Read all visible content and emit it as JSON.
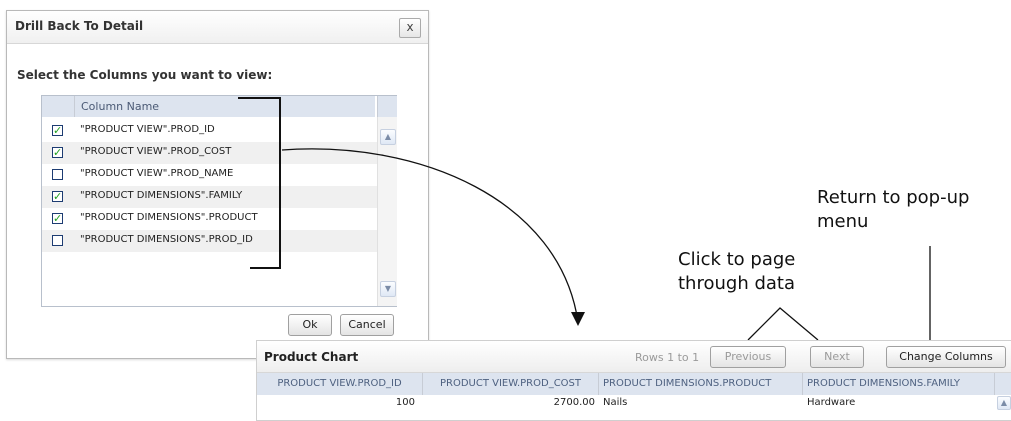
{
  "dialog": {
    "title": "Drill Back To Detail",
    "close_label": "x",
    "prompt": "Select the Columns you want to view:",
    "column_header": "Column Name",
    "columns": [
      {
        "label": "\"PRODUCT VIEW\".PROD_ID",
        "checked": true
      },
      {
        "label": "\"PRODUCT VIEW\".PROD_COST",
        "checked": true
      },
      {
        "label": "\"PRODUCT VIEW\".PROD_NAME",
        "checked": false
      },
      {
        "label": "\"PRODUCT DIMENSIONS\".FAMILY",
        "checked": true
      },
      {
        "label": "\"PRODUCT DIMENSIONS\".PRODUCT",
        "checked": true
      },
      {
        "label": "\"PRODUCT DIMENSIONS\".PROD_ID",
        "checked": false
      }
    ],
    "ok_label": "Ok",
    "cancel_label": "Cancel",
    "scroll_up_icon": "chevron-up-icon",
    "scroll_down_icon": "chevron-down-icon"
  },
  "callouts": {
    "return": "Return to pop-up menu",
    "return_line1": "Return to pop-up",
    "return_line2": "menu",
    "page_line1": "Click to page",
    "page_line2": "through data"
  },
  "panel": {
    "title": "Product Chart",
    "rows_text": "Rows 1 to 1",
    "previous_label": "Previous",
    "next_label": "Next",
    "change_columns_label": "Change Columns",
    "headers": [
      "PRODUCT VIEW.PROD_ID",
      "PRODUCT VIEW.PROD_COST",
      "PRODUCT DIMENSIONS.PRODUCT",
      "PRODUCT DIMENSIONS.FAMILY"
    ],
    "rows": [
      [
        "100",
        "2700.00",
        "Nails",
        "Hardware"
      ]
    ]
  },
  "colors": {
    "header_bg": "#dde4ef",
    "check_color": "#21a121",
    "disabled_text": "#9a9a9a"
  }
}
